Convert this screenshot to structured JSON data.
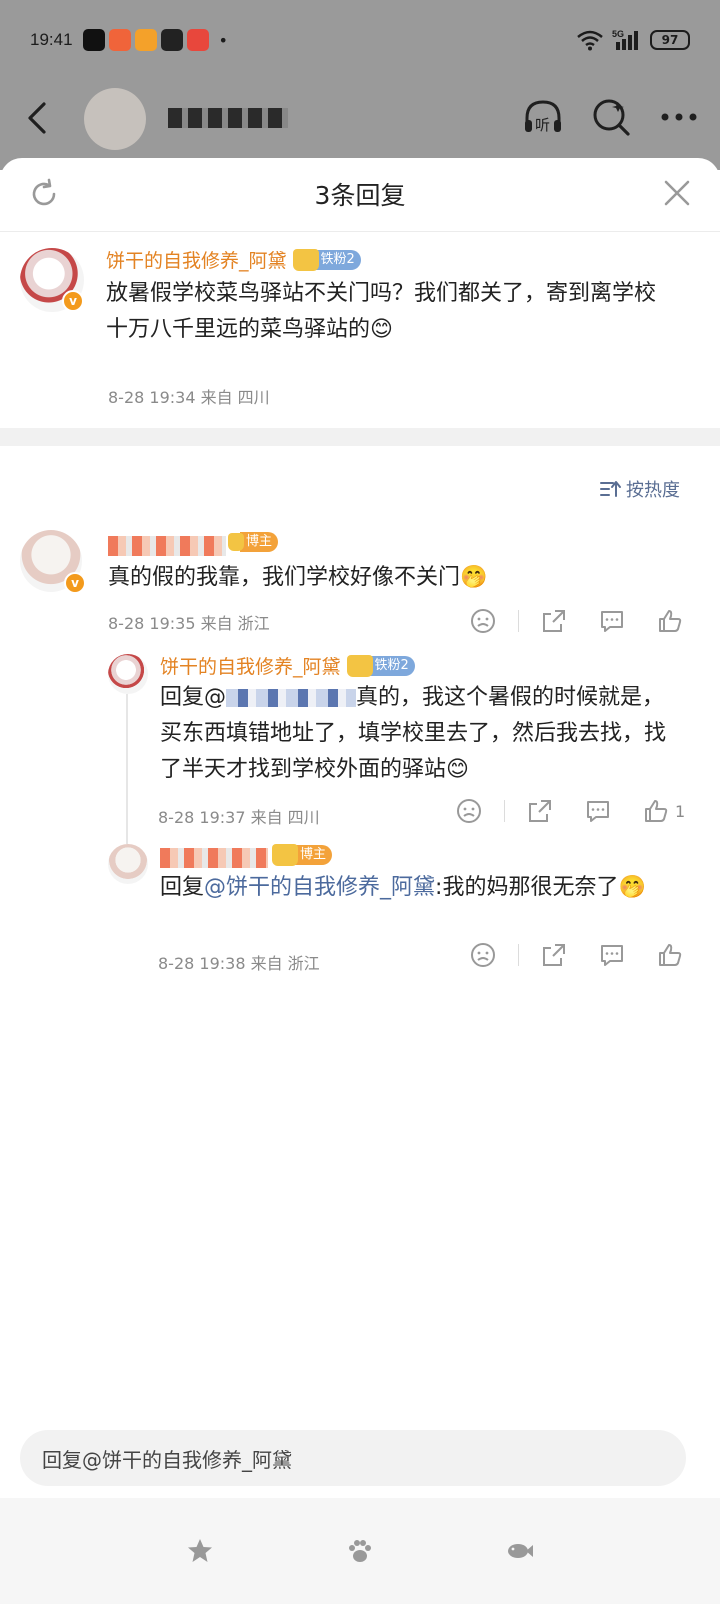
{
  "status_bar": {
    "time": "19:41",
    "more_dot": "•",
    "network": "5G",
    "battery": "97",
    "app_colors": [
      "#111111",
      "#f0643a",
      "#f4a12a",
      "#222222",
      "#e8473c"
    ]
  },
  "background_header": {
    "listen_label": "听"
  },
  "sheet": {
    "title": "3条回复"
  },
  "root_comment": {
    "username": "饼干的自我修养_阿黛",
    "fan_badge": "铁粉2",
    "text": "放暑假学校菜鸟驿站不关门吗？我们都关了，寄到离学校十万八千里远的菜鸟驿站的😊",
    "meta": "8-28 19:34  来自 四川"
  },
  "sort": {
    "label": "按热度"
  },
  "replies": [
    {
      "blogger_badge": "博主",
      "text": "真的假的我靠，我们学校好像不关门🤭",
      "meta": "8-28 19:35  来自 浙江"
    },
    {
      "username": "饼干的自我修养_阿黛",
      "fan_badge": "铁粉2",
      "reply_prefix": "回复@",
      "text": "真的，我这个暑假的时候就是，买东西填错地址了，填学校里去了，然后我去找，找了半天才找到学校外面的驿站😊",
      "meta": "8-28 19:37  来自 四川",
      "like_count": "1"
    },
    {
      "blogger_badge": "博主",
      "reply_prefix": "回复",
      "mention": "@饼干的自我修养_阿黛",
      "text": ":我的妈那很无奈了🤭",
      "meta": "8-28 19:38  来自 浙江"
    }
  ],
  "reply_box": {
    "placeholder": "回复@饼干的自我修养_阿黛"
  },
  "colors": {
    "username": "#e38323",
    "mention": "#4c6a9d",
    "fan_badge": "#7ea8dc",
    "blogger_badge": "#f3a23a"
  }
}
